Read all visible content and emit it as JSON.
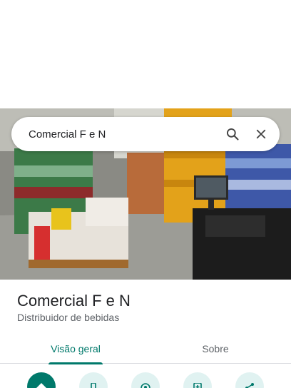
{
  "search": {
    "query": "Comercial F e N"
  },
  "place": {
    "name": "Comercial F e N",
    "category": "Distribuidor de bebidas"
  },
  "tabs": [
    {
      "label": "Visão geral",
      "active": true
    },
    {
      "label": "Sobre",
      "active": false
    }
  ],
  "actions": [
    {
      "icon": "directions-icon"
    },
    {
      "icon": "phone-icon"
    },
    {
      "icon": "nearby-icon"
    },
    {
      "icon": "save-to-phone-icon"
    },
    {
      "icon": "share-icon"
    }
  ],
  "colors": {
    "accent": "#00796b",
    "action_bg": "#e0f2f1",
    "text": "#202124",
    "secondary_text": "#5f6368"
  }
}
